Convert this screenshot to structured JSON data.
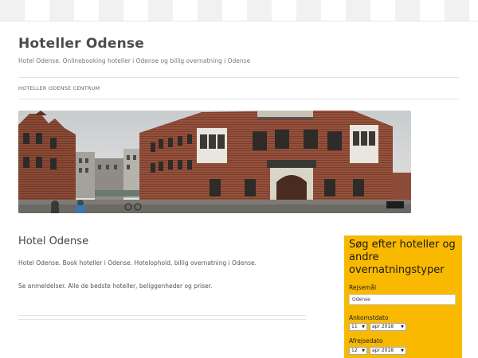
{
  "site": {
    "title": "Hoteller Odense",
    "description": "Hotel Odense. Onlinebooking hoteller i Odense og billig overnatning i Odense"
  },
  "nav": {
    "items": [
      "HOTELLER ODENSE CENTRUM"
    ]
  },
  "main": {
    "heading": "Hotel Odense",
    "paragraph1": "Hotel Odense. Book hoteller i Odense. Hotelophold, billig overnatning i Odense.",
    "paragraph2": "Se anmeldelser. Alle de bedste hoteller, beliggenheder og priser."
  },
  "widget": {
    "title": "Søg efter hoteller og andre overnatningstyper",
    "destination_label": "Rejsemål",
    "destination_value": "Odense",
    "checkin_label": "Ankomstdato",
    "checkin_day": "11",
    "checkin_month": "apr 2018",
    "checkout_label": "Afrejsedato",
    "checkout_day": "12",
    "checkout_month": "apr 2018"
  },
  "colors": {
    "widget_bg": "#f8b900",
    "title_text": "#4b4b4b"
  }
}
